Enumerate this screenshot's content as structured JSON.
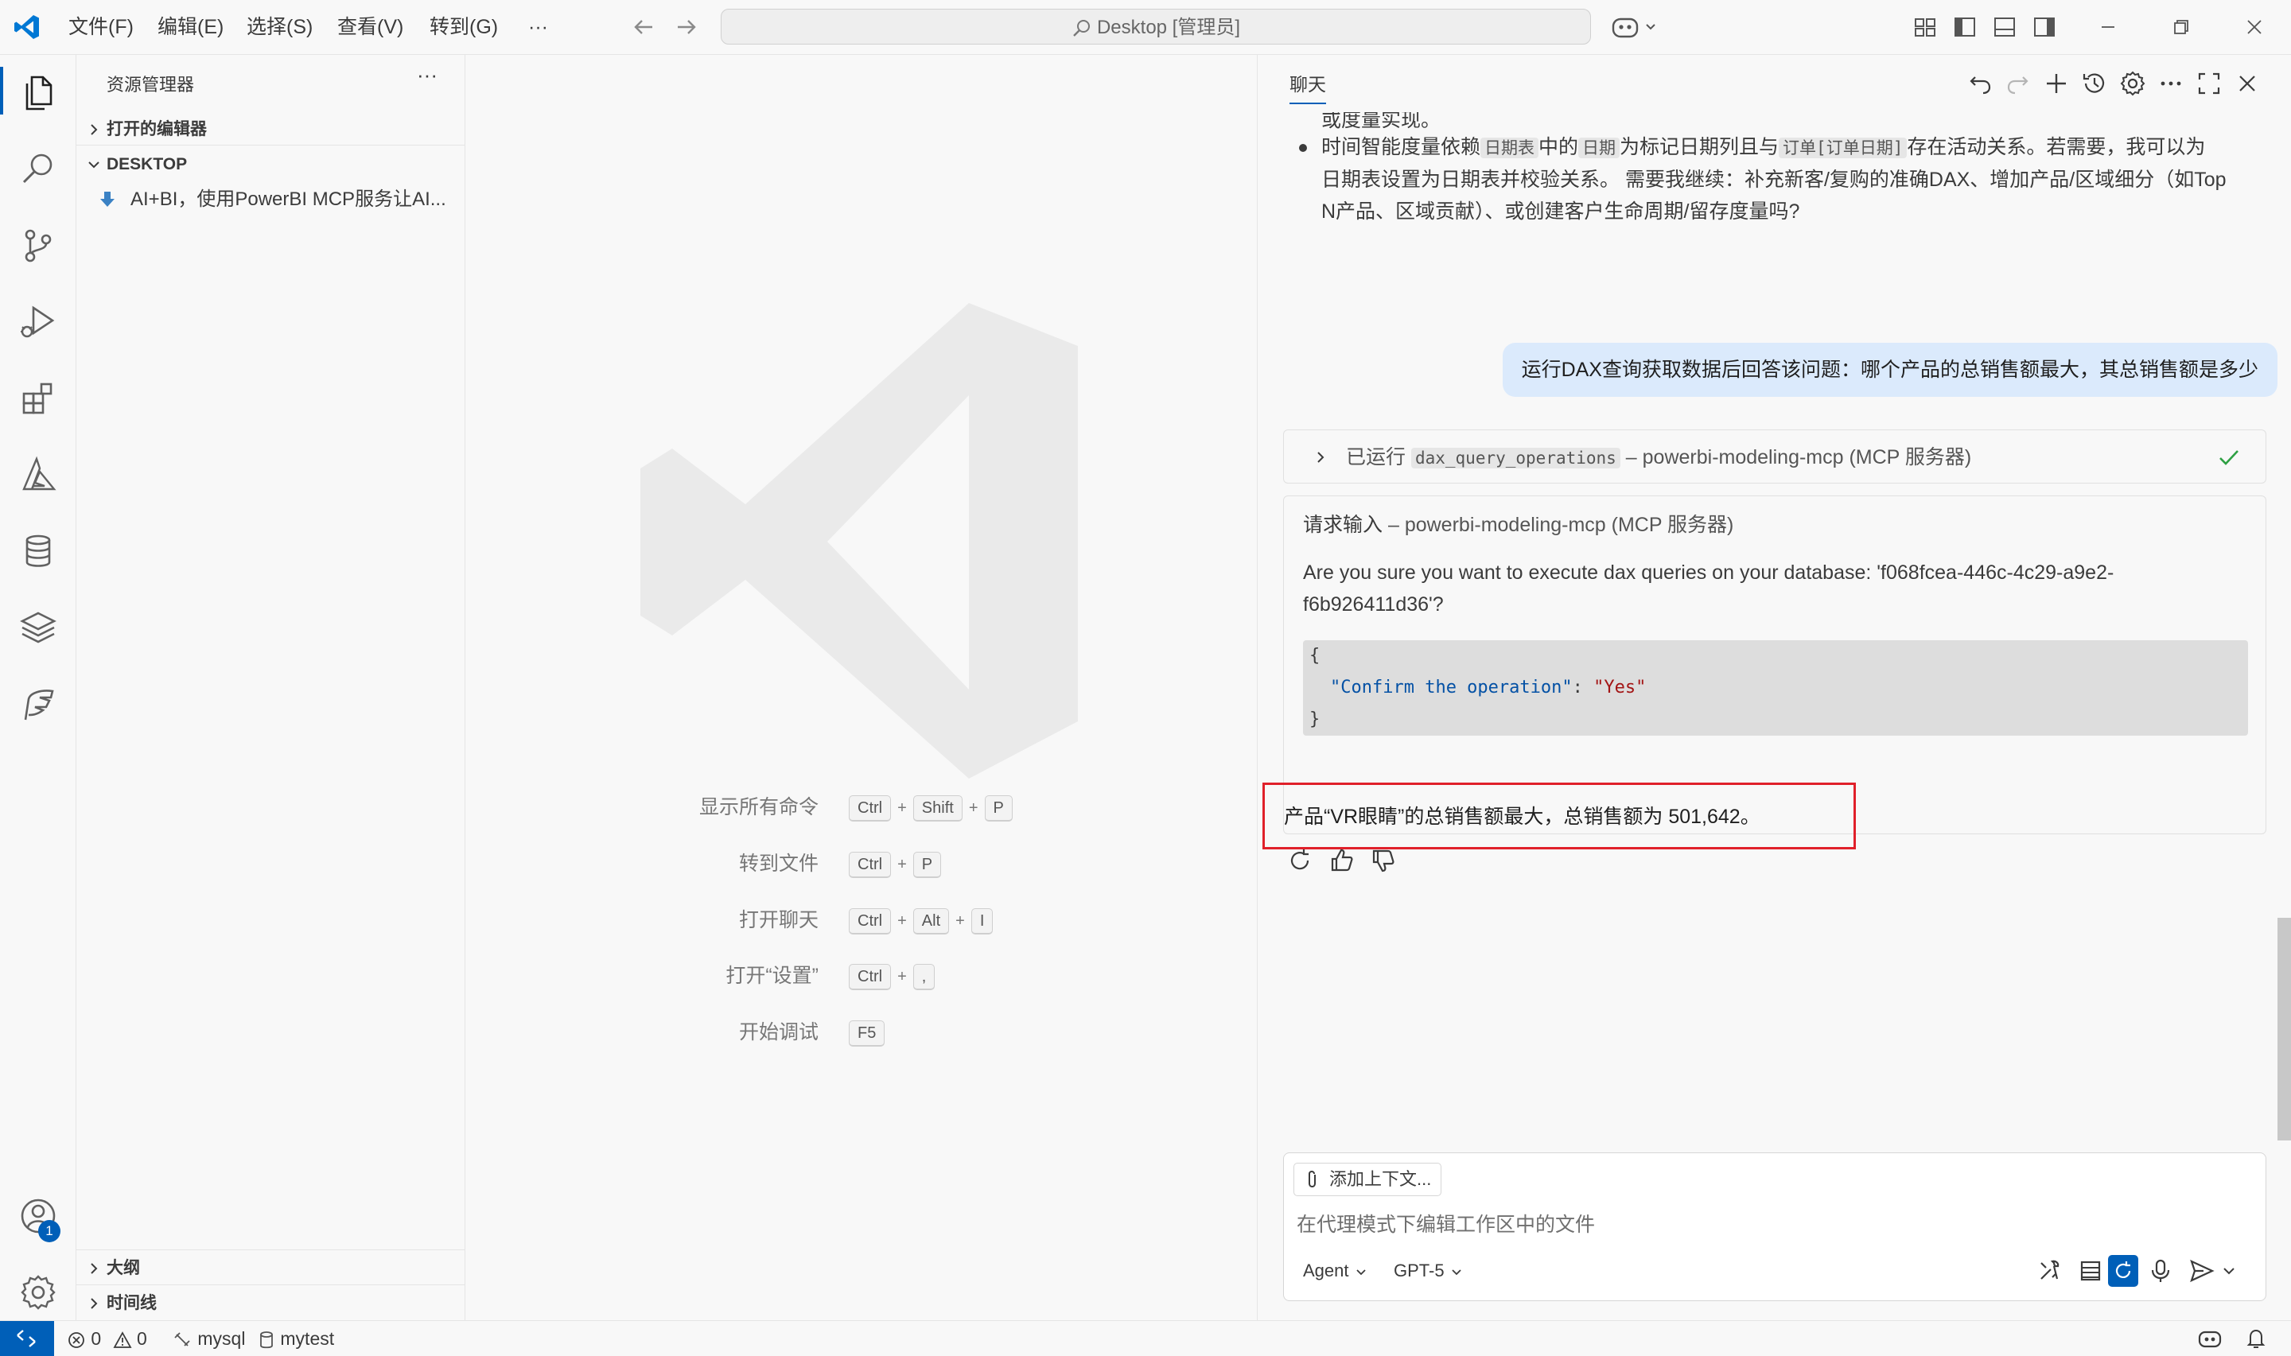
{
  "titlebar": {
    "menus": [
      "文件(F)",
      "编辑(E)",
      "选择(S)",
      "查看(V)",
      "转到(G)",
      "···"
    ],
    "search_text": "Desktop [管理员]"
  },
  "sidebar": {
    "title": "资源管理器",
    "more": "···",
    "open_editors": "打开的编辑器",
    "folder": "DESKTOP",
    "file_name": "AI+BI，使用PowerBI MCP服务让AI...",
    "outline": "大纲",
    "timeline": "时间线"
  },
  "editor": {
    "shortcuts": [
      {
        "label": "显示所有命令",
        "keys": [
          "Ctrl",
          "Shift",
          "P"
        ]
      },
      {
        "label": "转到文件",
        "keys": [
          "Ctrl",
          "P"
        ]
      },
      {
        "label": "打开聊天",
        "keys": [
          "Ctrl",
          "Alt",
          "I"
        ]
      },
      {
        "label": "打开“设置”",
        "keys": [
          "Ctrl",
          ","
        ]
      },
      {
        "label": "开始调试",
        "keys": [
          "F5"
        ]
      }
    ]
  },
  "chat": {
    "tab": "聊天",
    "prev_line_tail": "或度量实现。",
    "bullet": {
      "p1": "时间智能度量依赖",
      "c1": "日期表",
      "p2": "中的",
      "c2": "日期",
      "p3": "为标记日期列且与",
      "c3": "订单[订单日期]",
      "p4": "存在活动关系。若需要，我可以为",
      "line2": "日期表设置为日期表并校验关系。 需要我继续：补充新客/复购的准确DAX、增加产品/区域细分（如Top",
      "line3": "N产品、区域贡献）、或创建客户生命周期/留存度量吗?"
    },
    "user_message": "运行DAX查询获取数据后回答该问题：哪个产品的总销售额最大，其总销售额是多少",
    "tool_run": {
      "prefix": "已运行",
      "tool": "dax_query_operations",
      "suffix": "– powerbi-modeling-mcp (MCP 服务器)"
    },
    "confirm": {
      "title": "请求输入",
      "title_suffix": "– powerbi-modeling-mcp (MCP 服务器)",
      "line1": "Are you sure you want to execute dax queries on your database: 'f068fcea-446c-4c29-a9e2-",
      "line2": "f6b926411d36'?",
      "code_open": "{",
      "code_key": "\"Confirm the operation\"",
      "code_sep": ": ",
      "code_val": "\"Yes\"",
      "code_close": "}"
    },
    "answer": "产品“VR眼睛”的总销售额最大，总销售额为 501,642。",
    "input": {
      "add_context": "添加上下文...",
      "placeholder": "在代理模式下编辑工作区中的文件",
      "mode": "Agent",
      "model": "GPT-5"
    }
  },
  "status": {
    "errors": "0",
    "warnings": "0",
    "db": "mysql",
    "schema": "mytest",
    "badge": "1"
  },
  "colors": {
    "accent": "#005fb8",
    "highlight_border": "#e0202a",
    "user_bubble": "#dbeafc",
    "success": "#2ea043"
  }
}
